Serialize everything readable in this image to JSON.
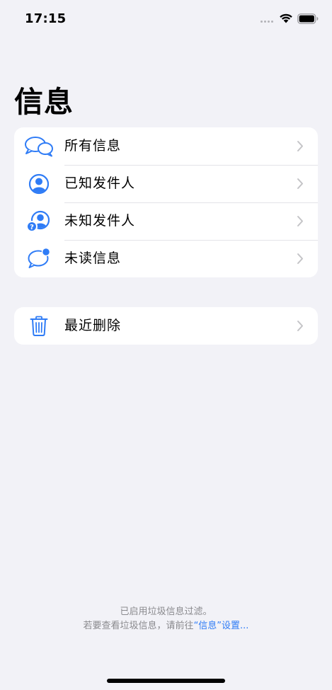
{
  "status_bar": {
    "time": "17:15"
  },
  "page": {
    "title": "信息"
  },
  "filters": {
    "items": [
      {
        "label": "所有信息",
        "icon": "two-speech-bubbles-icon"
      },
      {
        "label": "已知发件人",
        "icon": "person-circle-icon"
      },
      {
        "label": "未知发件人",
        "icon": "person-question-icon"
      },
      {
        "label": "未读信息",
        "icon": "speech-bubble-unread-icon"
      }
    ]
  },
  "deleted": {
    "label": "最近删除",
    "icon": "trash-icon"
  },
  "footer": {
    "line1": "已启用垃圾信息过滤。",
    "line2_prefix": "若要查看垃圾信息，请前往",
    "line2_link": "“信息”设置..."
  },
  "colors": {
    "accent": "#2f7cf6",
    "background": "#f2f2f7",
    "card": "#ffffff",
    "separator": "#e3e3e8",
    "chevron": "#c4c4c7",
    "footer_text": "#8a8a8e"
  }
}
